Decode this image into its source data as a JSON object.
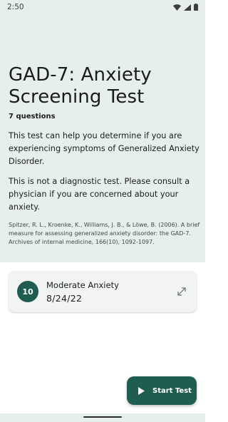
{
  "status_bar": {
    "time": "2:50",
    "icons": [
      "wifi-icon",
      "signal-icon",
      "battery-icon"
    ]
  },
  "screen": {
    "title": "GAD-7: Anxiety Screening Test",
    "question_count": "7 questions",
    "description": "This test can help you determine if you are experiencing symptoms of Generalized Anxiety Disorder.",
    "disclaimer": "This is not a diagnostic test. Please consult a physician if you are concerned about your anxiety.",
    "citation": "Spitzer, R. L., Kroenke, K., Williams, J. B., & Löwe, B. (2006). A brief measure for assessing generalized anxiety disorder: the GAD-7. Archives of internal medicine, 166(10), 1092-1097."
  },
  "result": {
    "score": "10",
    "label": "Moderate Anxiety",
    "date": "8/24/22",
    "icon": "expand-icon"
  },
  "fab": {
    "label": "Start Test",
    "icon": "play-icon"
  },
  "colors": {
    "header_background": "#e6efec",
    "accent": "#1e5d4f",
    "card_background": "#f1f4f3"
  }
}
